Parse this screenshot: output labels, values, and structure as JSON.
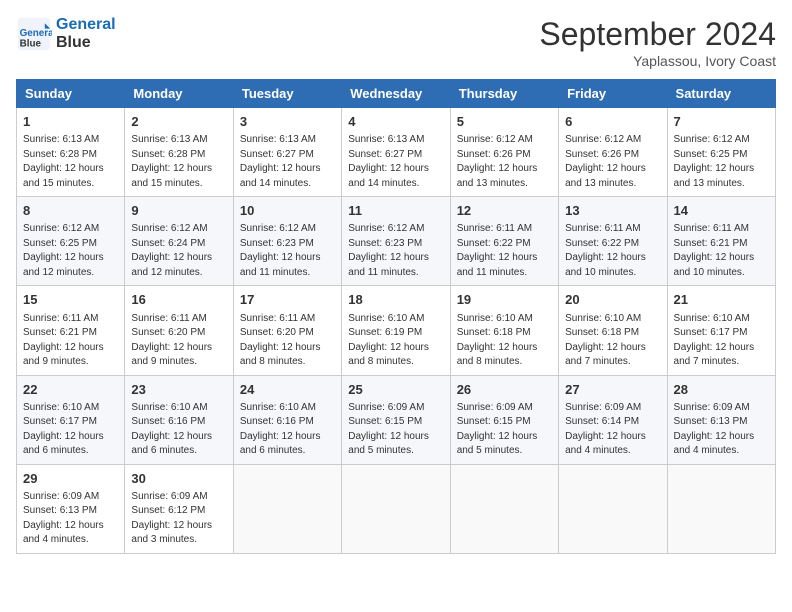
{
  "header": {
    "logo_line1": "General",
    "logo_line2": "Blue",
    "month": "September 2024",
    "location": "Yaplassou, Ivory Coast"
  },
  "weekdays": [
    "Sunday",
    "Monday",
    "Tuesday",
    "Wednesday",
    "Thursday",
    "Friday",
    "Saturday"
  ],
  "weeks": [
    [
      {
        "day": "1",
        "lines": [
          "Sunrise: 6:13 AM",
          "Sunset: 6:28 PM",
          "Daylight: 12 hours",
          "and 15 minutes."
        ]
      },
      {
        "day": "2",
        "lines": [
          "Sunrise: 6:13 AM",
          "Sunset: 6:28 PM",
          "Daylight: 12 hours",
          "and 15 minutes."
        ]
      },
      {
        "day": "3",
        "lines": [
          "Sunrise: 6:13 AM",
          "Sunset: 6:27 PM",
          "Daylight: 12 hours",
          "and 14 minutes."
        ]
      },
      {
        "day": "4",
        "lines": [
          "Sunrise: 6:13 AM",
          "Sunset: 6:27 PM",
          "Daylight: 12 hours",
          "and 14 minutes."
        ]
      },
      {
        "day": "5",
        "lines": [
          "Sunrise: 6:12 AM",
          "Sunset: 6:26 PM",
          "Daylight: 12 hours",
          "and 13 minutes."
        ]
      },
      {
        "day": "6",
        "lines": [
          "Sunrise: 6:12 AM",
          "Sunset: 6:26 PM",
          "Daylight: 12 hours",
          "and 13 minutes."
        ]
      },
      {
        "day": "7",
        "lines": [
          "Sunrise: 6:12 AM",
          "Sunset: 6:25 PM",
          "Daylight: 12 hours",
          "and 13 minutes."
        ]
      }
    ],
    [
      {
        "day": "8",
        "lines": [
          "Sunrise: 6:12 AM",
          "Sunset: 6:25 PM",
          "Daylight: 12 hours",
          "and 12 minutes."
        ]
      },
      {
        "day": "9",
        "lines": [
          "Sunrise: 6:12 AM",
          "Sunset: 6:24 PM",
          "Daylight: 12 hours",
          "and 12 minutes."
        ]
      },
      {
        "day": "10",
        "lines": [
          "Sunrise: 6:12 AM",
          "Sunset: 6:23 PM",
          "Daylight: 12 hours",
          "and 11 minutes."
        ]
      },
      {
        "day": "11",
        "lines": [
          "Sunrise: 6:12 AM",
          "Sunset: 6:23 PM",
          "Daylight: 12 hours",
          "and 11 minutes."
        ]
      },
      {
        "day": "12",
        "lines": [
          "Sunrise: 6:11 AM",
          "Sunset: 6:22 PM",
          "Daylight: 12 hours",
          "and 11 minutes."
        ]
      },
      {
        "day": "13",
        "lines": [
          "Sunrise: 6:11 AM",
          "Sunset: 6:22 PM",
          "Daylight: 12 hours",
          "and 10 minutes."
        ]
      },
      {
        "day": "14",
        "lines": [
          "Sunrise: 6:11 AM",
          "Sunset: 6:21 PM",
          "Daylight: 12 hours",
          "and 10 minutes."
        ]
      }
    ],
    [
      {
        "day": "15",
        "lines": [
          "Sunrise: 6:11 AM",
          "Sunset: 6:21 PM",
          "Daylight: 12 hours",
          "and 9 minutes."
        ]
      },
      {
        "day": "16",
        "lines": [
          "Sunrise: 6:11 AM",
          "Sunset: 6:20 PM",
          "Daylight: 12 hours",
          "and 9 minutes."
        ]
      },
      {
        "day": "17",
        "lines": [
          "Sunrise: 6:11 AM",
          "Sunset: 6:20 PM",
          "Daylight: 12 hours",
          "and 8 minutes."
        ]
      },
      {
        "day": "18",
        "lines": [
          "Sunrise: 6:10 AM",
          "Sunset: 6:19 PM",
          "Daylight: 12 hours",
          "and 8 minutes."
        ]
      },
      {
        "day": "19",
        "lines": [
          "Sunrise: 6:10 AM",
          "Sunset: 6:18 PM",
          "Daylight: 12 hours",
          "and 8 minutes."
        ]
      },
      {
        "day": "20",
        "lines": [
          "Sunrise: 6:10 AM",
          "Sunset: 6:18 PM",
          "Daylight: 12 hours",
          "and 7 minutes."
        ]
      },
      {
        "day": "21",
        "lines": [
          "Sunrise: 6:10 AM",
          "Sunset: 6:17 PM",
          "Daylight: 12 hours",
          "and 7 minutes."
        ]
      }
    ],
    [
      {
        "day": "22",
        "lines": [
          "Sunrise: 6:10 AM",
          "Sunset: 6:17 PM",
          "Daylight: 12 hours",
          "and 6 minutes."
        ]
      },
      {
        "day": "23",
        "lines": [
          "Sunrise: 6:10 AM",
          "Sunset: 6:16 PM",
          "Daylight: 12 hours",
          "and 6 minutes."
        ]
      },
      {
        "day": "24",
        "lines": [
          "Sunrise: 6:10 AM",
          "Sunset: 6:16 PM",
          "Daylight: 12 hours",
          "and 6 minutes."
        ]
      },
      {
        "day": "25",
        "lines": [
          "Sunrise: 6:09 AM",
          "Sunset: 6:15 PM",
          "Daylight: 12 hours",
          "and 5 minutes."
        ]
      },
      {
        "day": "26",
        "lines": [
          "Sunrise: 6:09 AM",
          "Sunset: 6:15 PM",
          "Daylight: 12 hours",
          "and 5 minutes."
        ]
      },
      {
        "day": "27",
        "lines": [
          "Sunrise: 6:09 AM",
          "Sunset: 6:14 PM",
          "Daylight: 12 hours",
          "and 4 minutes."
        ]
      },
      {
        "day": "28",
        "lines": [
          "Sunrise: 6:09 AM",
          "Sunset: 6:13 PM",
          "Daylight: 12 hours",
          "and 4 minutes."
        ]
      }
    ],
    [
      {
        "day": "29",
        "lines": [
          "Sunrise: 6:09 AM",
          "Sunset: 6:13 PM",
          "Daylight: 12 hours",
          "and 4 minutes."
        ]
      },
      {
        "day": "30",
        "lines": [
          "Sunrise: 6:09 AM",
          "Sunset: 6:12 PM",
          "Daylight: 12 hours",
          "and 3 minutes."
        ]
      },
      {
        "day": "",
        "lines": []
      },
      {
        "day": "",
        "lines": []
      },
      {
        "day": "",
        "lines": []
      },
      {
        "day": "",
        "lines": []
      },
      {
        "day": "",
        "lines": []
      }
    ]
  ]
}
